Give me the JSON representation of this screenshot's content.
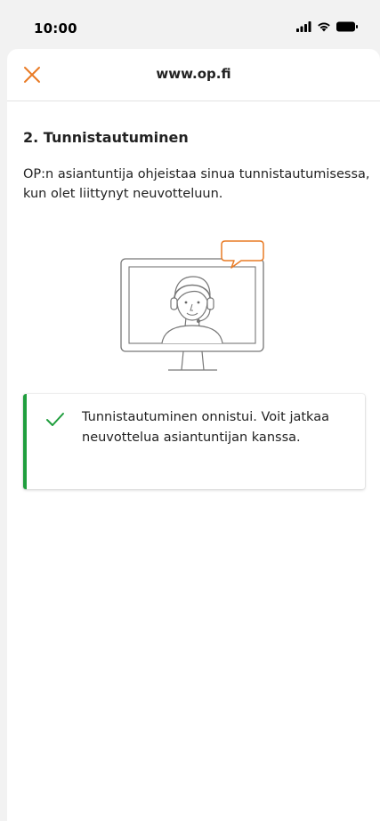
{
  "status_bar": {
    "time": "10:00",
    "icons": [
      "signal-icon",
      "wifi-icon",
      "battery-icon"
    ]
  },
  "header": {
    "url": "www.op.fi",
    "close_icon": "close-icon",
    "accent_color": "#e97b25"
  },
  "main": {
    "step_title": "2. Tunnistautuminen",
    "description": "OP:n asiantuntija ohjeistaa sinua tunnistautumisessa, kun olet liittynyt neuvotteluun.",
    "illustration_icon": "advisor-on-screen-icon"
  },
  "notice": {
    "status": "success",
    "icon": "checkmark-icon",
    "color": "#1f9e3d",
    "message": "Tunnistautuminen onnistui. Voit jatkaa neuvottelua asiantuntijan kanssa."
  }
}
